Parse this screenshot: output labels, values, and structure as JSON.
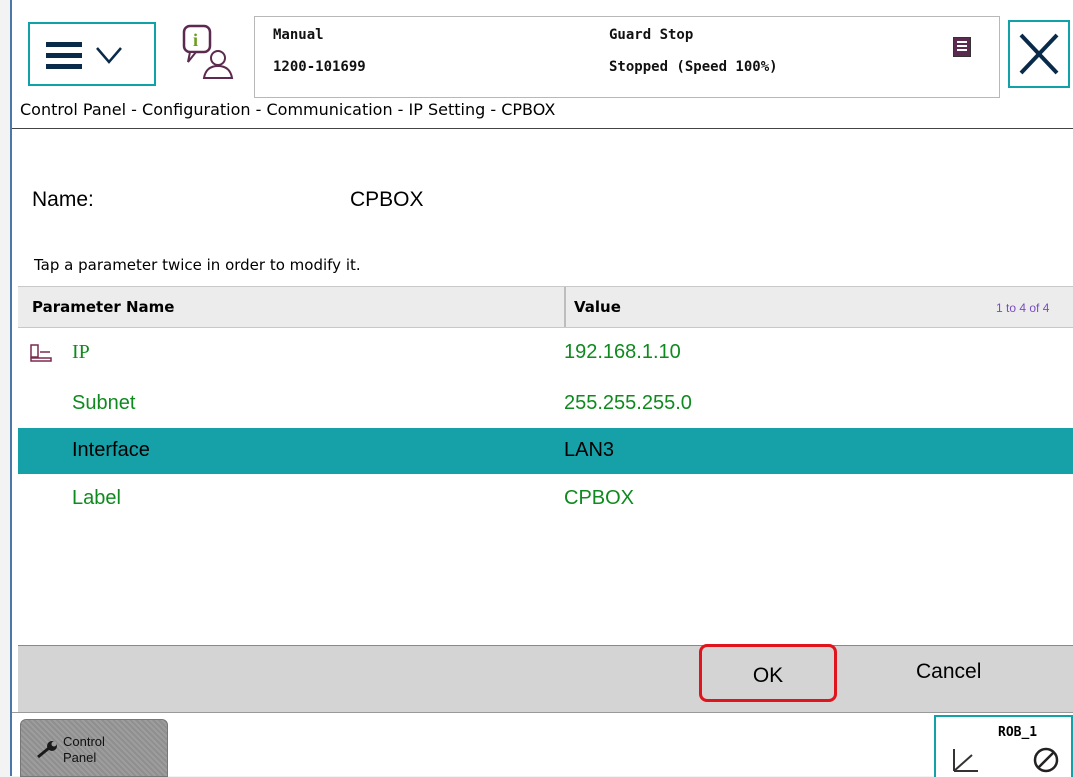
{
  "status": {
    "mode": "Manual",
    "controller_id": "1200-101699",
    "state": "Guard Stop",
    "speed": "Stopped (Speed 100%)"
  },
  "breadcrumb": "Control Panel - Configuration - Communication - IP Setting - CPBOX",
  "name_label": "Name:",
  "name_value": "CPBOX",
  "hint": "Tap a parameter twice in order to modify it.",
  "table": {
    "col_name": "Parameter Name",
    "col_value": "Value",
    "range": "1 to 4 of 4",
    "rows": [
      {
        "name": "IP",
        "value": "192.168.1.10"
      },
      {
        "name": "Subnet",
        "value": "255.255.255.0"
      },
      {
        "name": "Interface",
        "value": "LAN3"
      },
      {
        "name": "Label",
        "value": "CPBOX"
      }
    ]
  },
  "actions": {
    "ok": "OK",
    "cancel": "Cancel"
  },
  "taskbar": {
    "control_panel_line1": "Control",
    "control_panel_line2": "Panel",
    "robot": "ROB_1"
  },
  "colors": {
    "accent": "#16a0a8",
    "value_green": "#0f8a1e",
    "highlight_red": "#e0141c"
  }
}
